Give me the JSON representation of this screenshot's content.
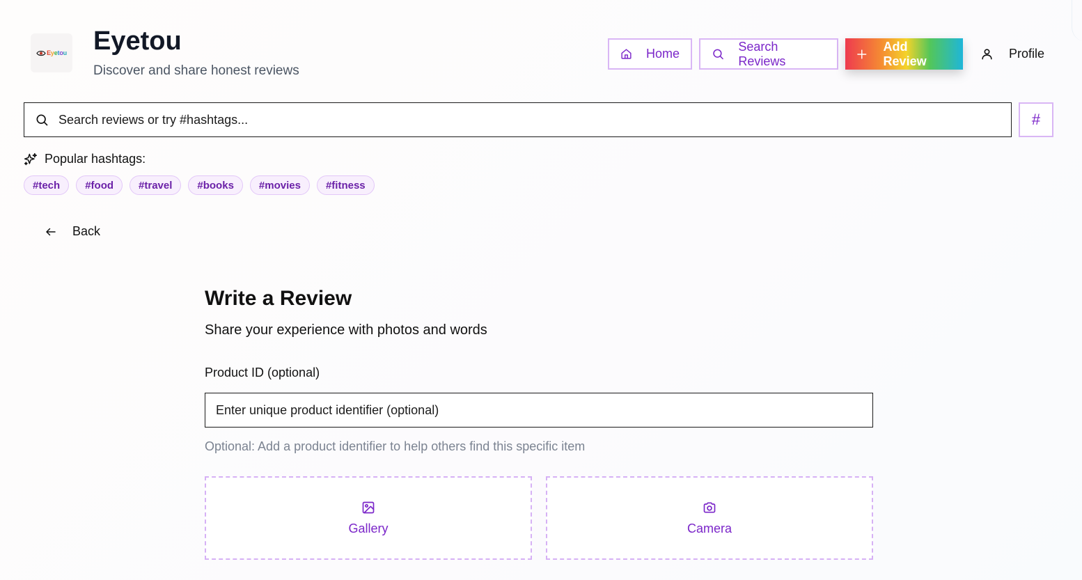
{
  "header": {
    "logo_text": "Eyetou",
    "title": "Eyetou",
    "subtitle": "Discover and share honest reviews"
  },
  "nav": {
    "home": {
      "label": "Home",
      "icon": "home-icon"
    },
    "search": {
      "label": "Search Reviews",
      "icon": "search-icon"
    },
    "add": {
      "label": "Add Review",
      "icon": "plus-icon"
    },
    "profile": {
      "label": "Profile",
      "icon": "user-icon"
    }
  },
  "search": {
    "placeholder": "Search reviews or try #hashtags...",
    "hashtag_button": "#"
  },
  "popular": {
    "label": "Popular hashtags:",
    "icon": "sparkles-icon",
    "tags": [
      "#tech",
      "#food",
      "#travel",
      "#books",
      "#movies",
      "#fitness"
    ]
  },
  "back": {
    "label": "Back",
    "icon": "arrow-left-icon"
  },
  "form": {
    "title": "Write a Review",
    "subtitle": "Share your experience with photos and words",
    "product_id": {
      "label": "Product ID (optional)",
      "placeholder": "Enter unique product identifier (optional)",
      "hint": "Optional: Add a product identifier to help others find this specific item"
    },
    "uploads": {
      "gallery": {
        "label": "Gallery",
        "icon": "image-icon"
      },
      "camera": {
        "label": "Camera",
        "icon": "camera-icon"
      }
    }
  },
  "colors": {
    "accent": "#7b26c9",
    "accent_border": "#d9b6f5",
    "tag_bg": "#f8effd",
    "hint": "#7b8391"
  }
}
